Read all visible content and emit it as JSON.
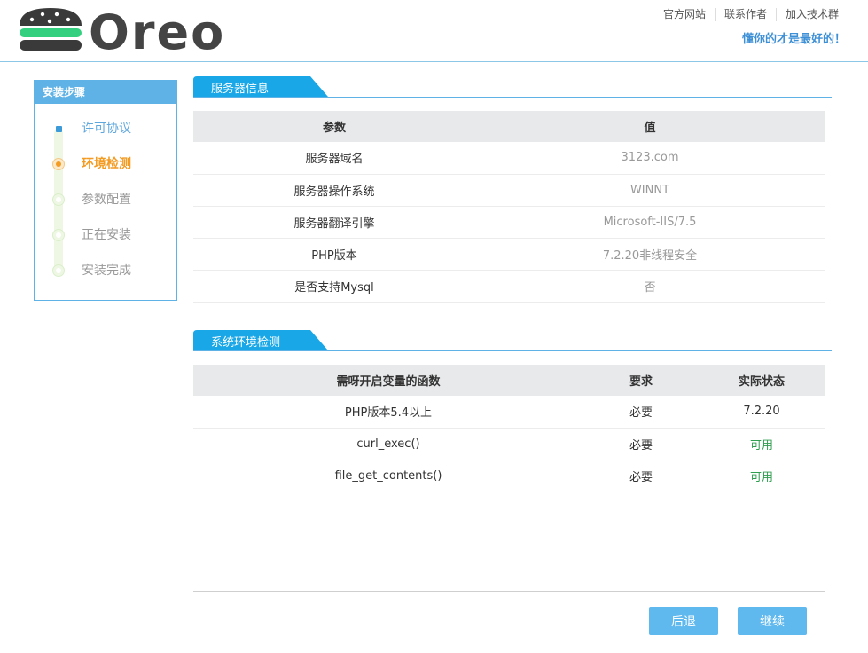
{
  "header": {
    "logo_text": "Oreo",
    "links": [
      "官方网站",
      "联系作者",
      "加入技术群"
    ],
    "slogan": "懂你的才是最好的！"
  },
  "sidebar": {
    "title": "安装步骤",
    "steps": [
      {
        "label": "许可协议",
        "state": "done"
      },
      {
        "label": "环境检测",
        "state": "current"
      },
      {
        "label": "参数配置",
        "state": "pending"
      },
      {
        "label": "正在安装",
        "state": "pending"
      },
      {
        "label": "安装完成",
        "state": "pending"
      }
    ]
  },
  "server_info": {
    "title": "服务器信息",
    "columns": [
      "参数",
      "值"
    ],
    "rows": [
      [
        "服务器域名",
        "3123.com"
      ],
      [
        "服务器操作系统",
        "WINNT"
      ],
      [
        "服务器翻译引擎",
        "Microsoft-IIS/7.5"
      ],
      [
        "PHP版本",
        "7.2.20非线程安全"
      ],
      [
        "是否支持Mysql",
        "否"
      ]
    ]
  },
  "env_check": {
    "title": "系统环境检测",
    "columns": [
      "需呀开启变量的函数",
      "要求",
      "实际状态"
    ],
    "rows": [
      [
        "PHP版本5.4以上",
        "必要",
        "7.2.20"
      ],
      [
        "curl_exec()",
        "必要",
        "可用"
      ],
      [
        "file_get_contents()",
        "必要",
        "可用"
      ]
    ]
  },
  "buttons": {
    "back": "后退",
    "next": "继续"
  },
  "colors": {
    "accent": "#5fb2e6",
    "slogan": "#3d8fd6",
    "current_step": "#f39b22",
    "ok": "#2e9e4f"
  }
}
